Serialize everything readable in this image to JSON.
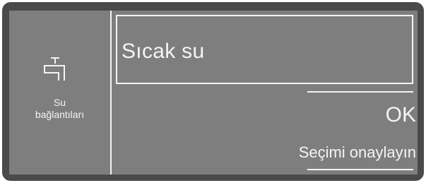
{
  "sidebar": {
    "icon": "water-tap-icon",
    "label_line1": "Su",
    "label_line2": "bağlantıları"
  },
  "main": {
    "selected_option": "Sıcak su",
    "ok_label": "OK",
    "hint": "Seçimi onaylayın"
  },
  "colors": {
    "bezel": "#4a4a4a",
    "screen": "#7e7e7e",
    "foreground": "#f4f4f4"
  }
}
